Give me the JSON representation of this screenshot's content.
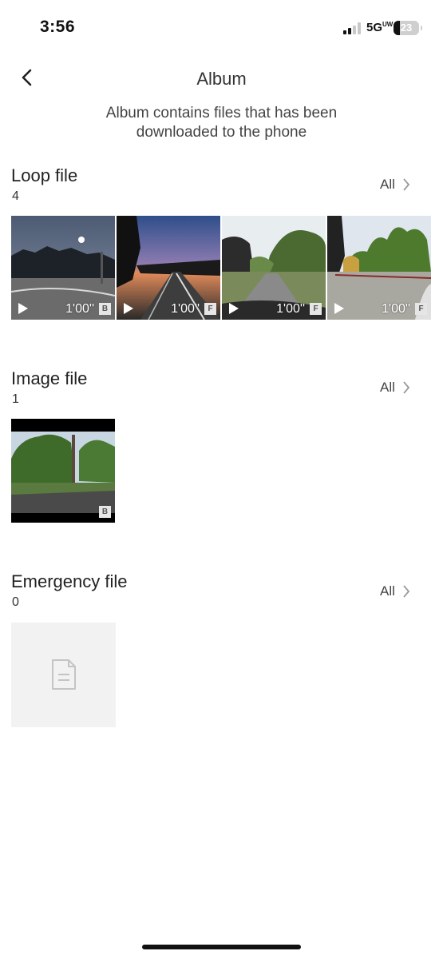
{
  "status_bar": {
    "time": "3:56",
    "network": "5G",
    "network_sub": "UW",
    "battery": "23"
  },
  "header": {
    "title": "Album",
    "subtitle": "Album contains files that has been downloaded to the phone"
  },
  "sections": {
    "loop": {
      "title": "Loop file",
      "count": "4",
      "all_label": "All",
      "items": [
        {
          "duration": "1'00''",
          "camera": "B"
        },
        {
          "duration": "1'00''",
          "camera": "F"
        },
        {
          "duration": "1'00''",
          "camera": "F"
        },
        {
          "duration": "1'00''",
          "camera": "F"
        }
      ]
    },
    "image": {
      "title": "Image file",
      "count": "1",
      "all_label": "All",
      "items": [
        {
          "camera": "B"
        }
      ]
    },
    "emergency": {
      "title": "Emergency file",
      "count": "0",
      "all_label": "All"
    }
  },
  "icons": {
    "back": "chevron-left-icon",
    "all": "chevron-right-icon",
    "play": "play-icon",
    "empty": "document-icon"
  },
  "colors": {
    "placeholder_bg": "#f2f2f2",
    "badge_bg": "#e6e6e6"
  }
}
